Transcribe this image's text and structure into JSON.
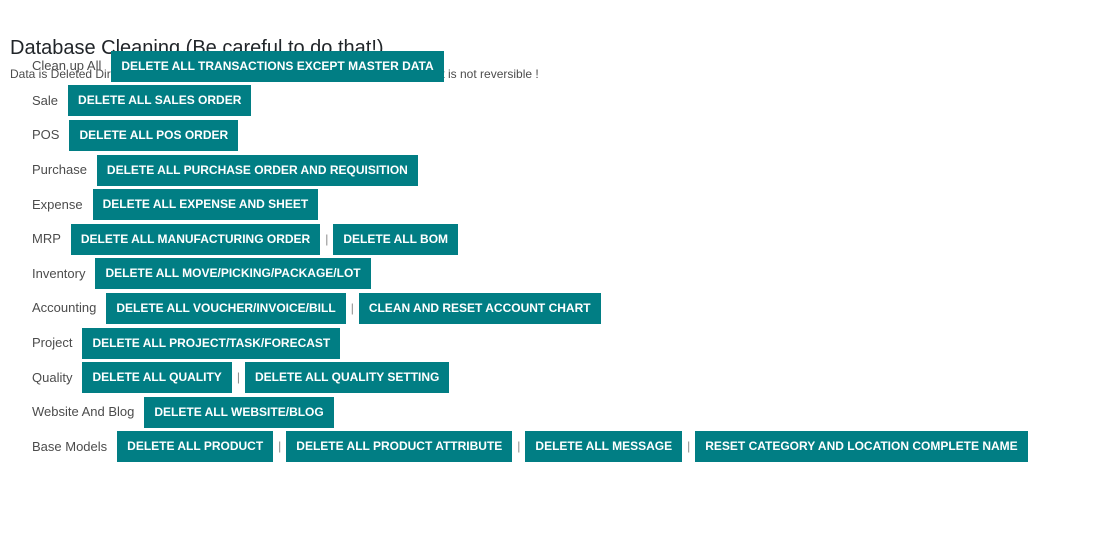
{
  "header": {
    "title": "Database Cleaning (Be careful to do that!)",
    "warning": "Data is Deleted Direcly from the Database Table using Queries, Once you done, It is not reversible !"
  },
  "separator": "|",
  "accent_color": "#017e84",
  "rows": [
    {
      "label": "Clean up All",
      "buttons": [
        "DELETE ALL TRANSACTIONS EXCEPT MASTER DATA"
      ]
    },
    {
      "label": "Sale",
      "buttons": [
        "DELETE ALL SALES ORDER"
      ]
    },
    {
      "label": "POS",
      "buttons": [
        "DELETE ALL POS ORDER"
      ]
    },
    {
      "label": "Purchase",
      "buttons": [
        "DELETE ALL PURCHASE ORDER AND REQUISITION"
      ]
    },
    {
      "label": "Expense",
      "buttons": [
        "DELETE ALL EXPENSE AND SHEET"
      ]
    },
    {
      "label": "MRP",
      "buttons": [
        "DELETE ALL MANUFACTURING ORDER",
        "DELETE ALL BOM"
      ]
    },
    {
      "label": "Inventory",
      "buttons": [
        "DELETE ALL MOVE/PICKING/PACKAGE/LOT"
      ]
    },
    {
      "label": "Accounting",
      "buttons": [
        "DELETE ALL VOUCHER/INVOICE/BILL",
        "CLEAN AND RESET ACCOUNT CHART"
      ]
    },
    {
      "label": "Project",
      "buttons": [
        "DELETE ALL PROJECT/TASK/FORECAST"
      ]
    },
    {
      "label": "Quality",
      "buttons": [
        "DELETE ALL QUALITY",
        "DELETE ALL QUALITY SETTING"
      ]
    },
    {
      "label": "Website And Blog",
      "buttons": [
        "DELETE ALL WEBSITE/BLOG"
      ]
    },
    {
      "label": "Base Models",
      "buttons": [
        "DELETE ALL PRODUCT",
        "DELETE ALL PRODUCT ATTRIBUTE",
        "DELETE ALL MESSAGE",
        "RESET CATEGORY AND LOCATION COMPLETE NAME"
      ]
    }
  ]
}
